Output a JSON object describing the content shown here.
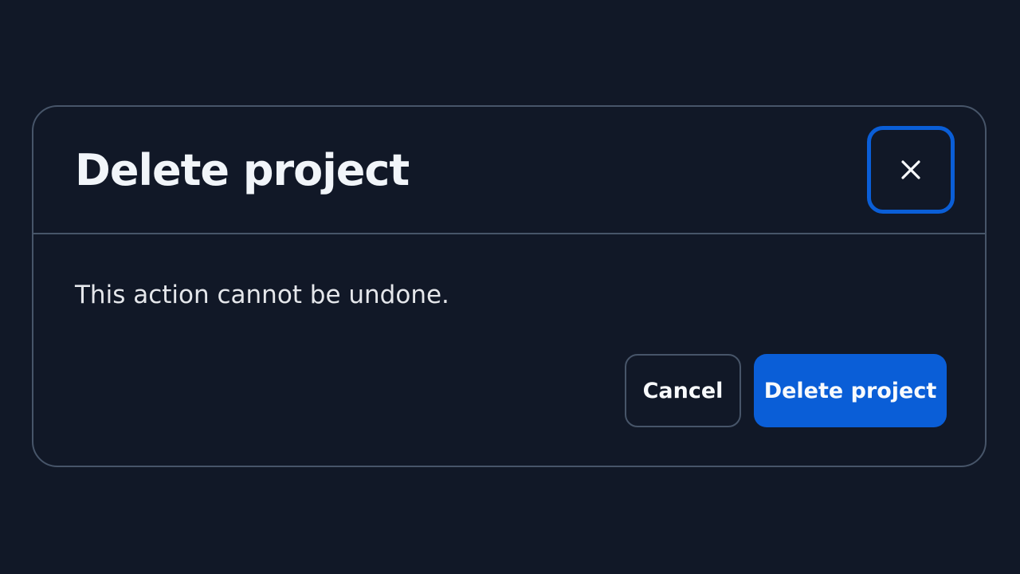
{
  "dialog": {
    "title": "Delete project",
    "message": "This action cannot be undone.",
    "close_icon": "close-icon",
    "cancel_label": "Cancel",
    "confirm_label": "Delete project"
  },
  "colors": {
    "background": "#111827",
    "border": "#475569",
    "accent": "#0a5ed7",
    "text": "#f1f5f9"
  }
}
